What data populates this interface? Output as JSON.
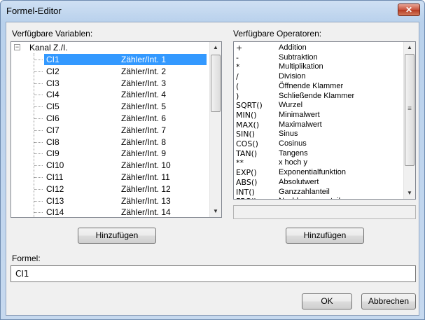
{
  "window": {
    "title": "Formel-Editor",
    "close_glyph": "✕"
  },
  "variables": {
    "label": "Verfügbare Variablen:",
    "root_label": "Kanal Z./I.",
    "expander_glyph": "−",
    "items": [
      {
        "name": "CI1",
        "desc": "Zähler/Int. 1"
      },
      {
        "name": "CI2",
        "desc": "Zähler/Int. 2"
      },
      {
        "name": "CI3",
        "desc": "Zähler/Int. 3"
      },
      {
        "name": "CI4",
        "desc": "Zähler/Int. 4"
      },
      {
        "name": "CI5",
        "desc": "Zähler/Int. 5"
      },
      {
        "name": "CI6",
        "desc": "Zähler/Int. 6"
      },
      {
        "name": "CI7",
        "desc": "Zähler/Int. 7"
      },
      {
        "name": "CI8",
        "desc": "Zähler/Int. 8"
      },
      {
        "name": "CI9",
        "desc": "Zähler/Int. 9"
      },
      {
        "name": "CI10",
        "desc": "Zähler/Int. 10"
      },
      {
        "name": "CI11",
        "desc": "Zähler/Int. 11"
      },
      {
        "name": "CI12",
        "desc": "Zähler/Int. 12"
      },
      {
        "name": "CI13",
        "desc": "Zähler/Int. 13"
      },
      {
        "name": "CI14",
        "desc": "Zähler/Int. 14"
      }
    ],
    "selected_index": 0,
    "add_button": "Hinzufügen"
  },
  "operators": {
    "label": "Verfügbare Operatoren:",
    "items": [
      {
        "sym": "+",
        "name": "Addition"
      },
      {
        "sym": "-",
        "name": "Subtraktion"
      },
      {
        "sym": "*",
        "name": "Multiplikation"
      },
      {
        "sym": "/",
        "name": "Division"
      },
      {
        "sym": "(",
        "name": "Öffnende Klammer"
      },
      {
        "sym": ")",
        "name": "Schließende Klammer"
      },
      {
        "sym": "SQRT()",
        "name": "Wurzel"
      },
      {
        "sym": "MIN()",
        "name": "Minimalwert"
      },
      {
        "sym": "MAX()",
        "name": "Maximalwert"
      },
      {
        "sym": "SIN()",
        "name": "Sinus"
      },
      {
        "sym": "COS()",
        "name": "Cosinus"
      },
      {
        "sym": "TAN()",
        "name": "Tangens"
      },
      {
        "sym": "**",
        "name": "x hoch y"
      },
      {
        "sym": "EXP()",
        "name": "Exponentialfunktion"
      },
      {
        "sym": "ABS()",
        "name": "Absolutwert"
      },
      {
        "sym": "INT()",
        "name": "Ganzzahlanteil"
      },
      {
        "sym": "FRC()",
        "name": "Nachkommaanteil"
      }
    ],
    "add_button": "Hinzufügen"
  },
  "formula": {
    "label": "Formel:",
    "value": "CI1"
  },
  "footer": {
    "ok_label": "OK",
    "cancel_label": "Abbrechen"
  },
  "scroll_glyphs": {
    "up": "▲",
    "down": "▼",
    "grip": "≡"
  }
}
